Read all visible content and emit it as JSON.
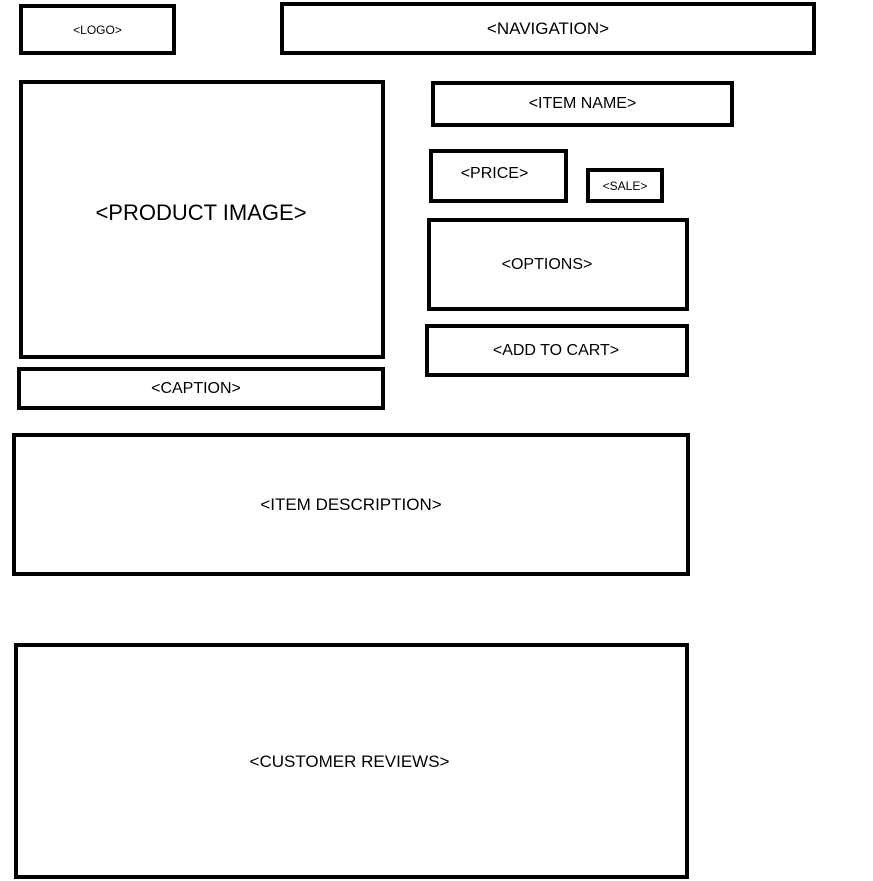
{
  "header": {
    "logo": "<LOGO>",
    "navigation": "<NAVIGATION>"
  },
  "product": {
    "image": "<PRODUCT IMAGE>",
    "caption": "<CAPTION>",
    "item_name": "<ITEM NAME>",
    "price": "<PRICE>",
    "sale": "<SALE>",
    "options": "<OPTIONS>",
    "add_to_cart": "<ADD TO CART>"
  },
  "content": {
    "item_description": "<ITEM DESCRIPTION>",
    "customer_reviews": "<CUSTOMER REVIEWS>"
  },
  "colors": {
    "border": "#000000",
    "background": "#ffffff"
  }
}
